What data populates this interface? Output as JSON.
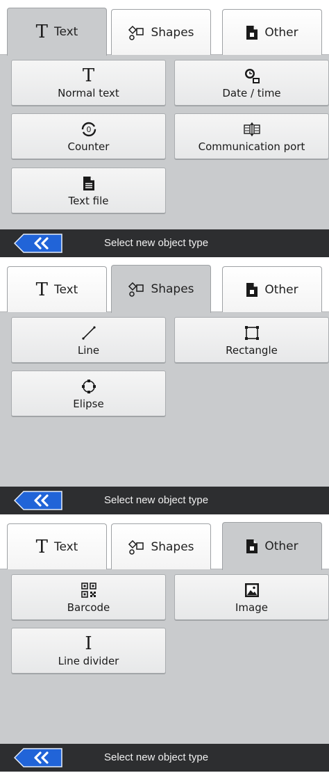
{
  "accent_color": "#1a5fd6",
  "panels": [
    {
      "id": "text",
      "active_tab": 0,
      "tabs": [
        {
          "label": "Text",
          "icon": "text-T-icon"
        },
        {
          "label": "Shapes",
          "icon": "shapes-icon"
        },
        {
          "label": "Other",
          "icon": "document-icon"
        }
      ],
      "buttons": [
        {
          "label": "Normal text",
          "icon": "text-T-icon"
        },
        {
          "label": "Date / time",
          "icon": "clock-icon"
        },
        {
          "label": "Counter",
          "icon": "counter-icon"
        },
        {
          "label": "Communication port",
          "icon": "communication-port-icon"
        },
        {
          "label": "Text file",
          "icon": "text-file-icon"
        }
      ],
      "status": "Select new object type"
    },
    {
      "id": "shapes",
      "active_tab": 1,
      "tabs": [
        {
          "label": "Text",
          "icon": "text-T-icon"
        },
        {
          "label": "Shapes",
          "icon": "shapes-icon"
        },
        {
          "label": "Other",
          "icon": "document-icon"
        }
      ],
      "buttons": [
        {
          "label": "Line",
          "icon": "line-icon"
        },
        {
          "label": "Rectangle",
          "icon": "rectangle-icon"
        },
        {
          "label": "Elipse",
          "icon": "ellipse-icon"
        }
      ],
      "status": "Select new object type"
    },
    {
      "id": "other",
      "active_tab": 2,
      "tabs": [
        {
          "label": "Text",
          "icon": "text-T-icon"
        },
        {
          "label": "Shapes",
          "icon": "shapes-icon"
        },
        {
          "label": "Other",
          "icon": "document-icon"
        }
      ],
      "buttons": [
        {
          "label": "Barcode",
          "icon": "barcode-icon"
        },
        {
          "label": "Image",
          "icon": "image-icon"
        },
        {
          "label": "Line divider",
          "icon": "line-divider-icon"
        }
      ],
      "status": "Select new object type"
    }
  ]
}
